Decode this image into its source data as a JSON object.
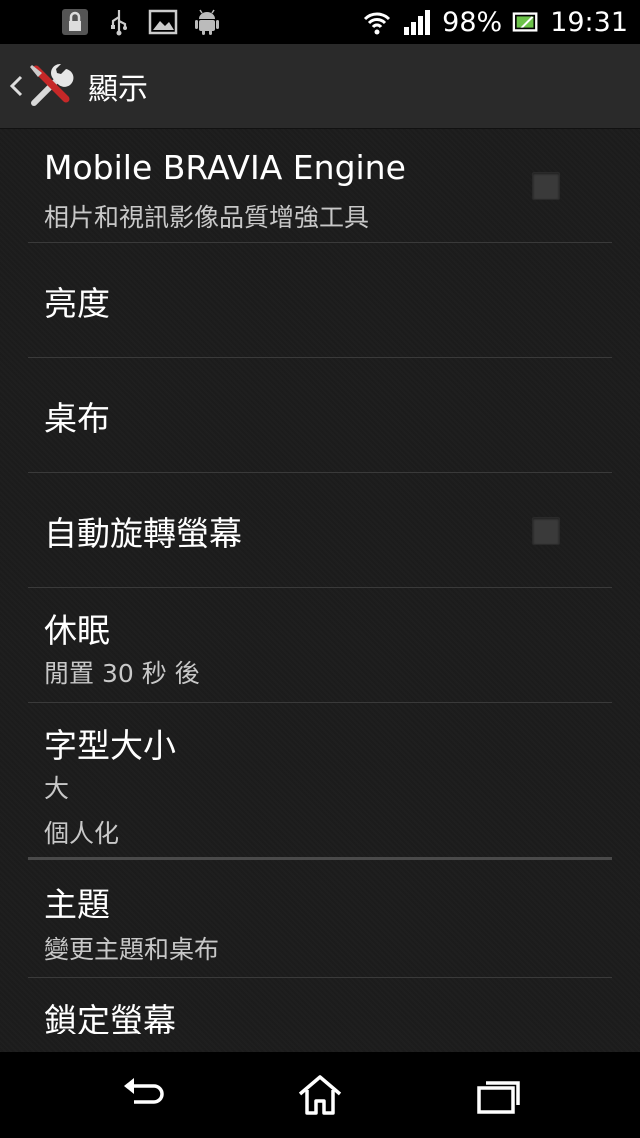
{
  "status_bar": {
    "battery_percent": "98%",
    "time": "19:31",
    "icons": [
      "lock-icon",
      "usb-icon",
      "picture-icon",
      "android-icon",
      "wifi-icon",
      "signal-icon",
      "battery-charging-icon"
    ]
  },
  "action_bar": {
    "title": "顯示",
    "app_icon": "tools-icon"
  },
  "settings": {
    "bravia": {
      "title": "Mobile BRAVIA Engine",
      "summary": "相片和視訊影像品質增強工具",
      "checked": false
    },
    "brightness": {
      "title": "亮度"
    },
    "wallpaper": {
      "title": "桌布"
    },
    "auto_rotate": {
      "title": "自動旋轉螢幕",
      "checked": false
    },
    "sleep": {
      "title": "休眠",
      "summary": "閒置 30 秒 後"
    },
    "font_size": {
      "title": "字型大小",
      "summary": "大"
    }
  },
  "personalization": {
    "header": "個人化",
    "themes": {
      "title": "主題",
      "summary": "變更主題和桌布"
    },
    "lock_screen": {
      "title": "鎖定螢幕"
    }
  },
  "nav_bar": {
    "icons": [
      "back-icon",
      "home-icon",
      "recents-icon"
    ]
  },
  "colors": {
    "background": "#1c1c1c",
    "status_bar": "#000000",
    "action_bar": "#2a2a2a",
    "divider": "#3a3a3a",
    "text_primary": "#ffffff",
    "text_secondary": "#c8c8c8"
  }
}
